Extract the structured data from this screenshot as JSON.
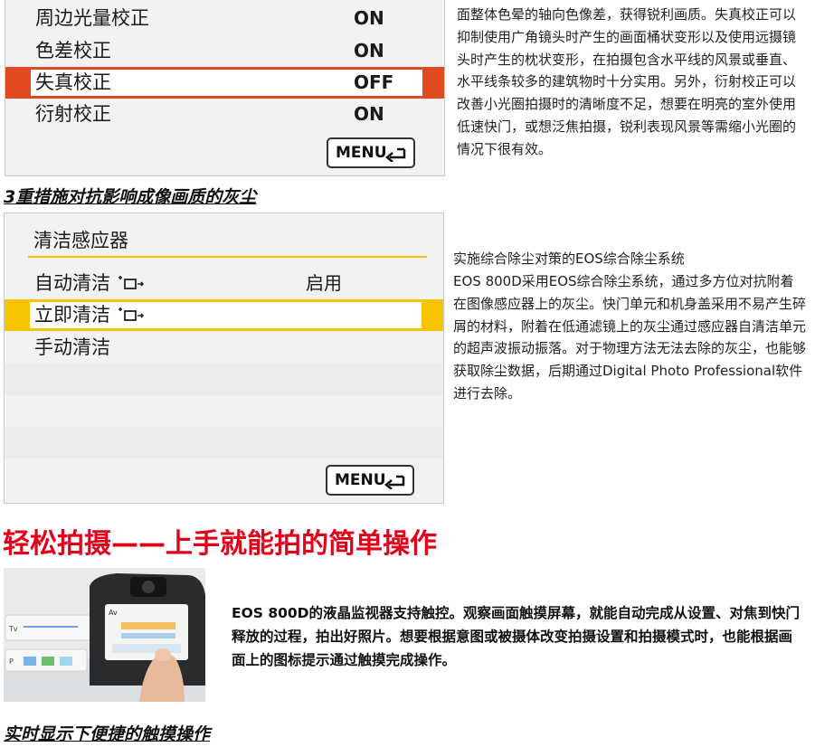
{
  "panel1": {
    "rows": [
      {
        "label": "周边光量校正",
        "value": "ON"
      },
      {
        "label": "色差校正",
        "value": "ON"
      },
      {
        "label": "失真校正",
        "value": "OFF"
      },
      {
        "label": "衍射校正",
        "value": "ON"
      }
    ],
    "menu_button": "MENU"
  },
  "paragraph1": "面整体色晕的轴向色像差，获得锐利画质。失真校正可以抑制使用广角镜头时产生的画面桶状变形以及使用远摄镜头时产生的枕状变形，在拍摄包含水平线的风景或垂直、水平线条较多的建筑物时十分实用。另外，衍射校正可以改善小光圈拍摄时的清晰度不足，想要在明亮的室外使用低速快门，或想泛焦拍摄，锐利表现风景等需缩小光圈的情况下很有效。",
  "section2_heading": "3重措施对抗影响成像画质的灰尘",
  "panel2": {
    "title": "清洁感应器",
    "rows": [
      {
        "label": "自动清洁",
        "value": "启用"
      },
      {
        "label": "立即清洁",
        "value": ""
      },
      {
        "label": "手动清洁",
        "value": ""
      }
    ],
    "menu_button": "MENU"
  },
  "paragraph2_title": "实施综合除尘对策的EOS综合除尘系统",
  "paragraph2": "EOS 800D采用EOS综合除尘系统，通过多方位对抗附着在图像感应器上的灰尘。快门单元和机身盖采用不易产生碎屑的材料，附着在低通滤镜上的灰尘通过感应器自清洁单元的超声波振动振落。对于物理方法无法去除的灰尘，也能够获取除尘数据，后期通过Digital Photo Professional软件进行去除。",
  "main_heading": "轻松拍摄——上手就能拍的简单操作",
  "touch_paragraph": "EOS 800D的液晶监视器支持触控。观察画面触摸屏幕，就能自动完成从设置、对焦到快门释放的过程，拍出好照片。想要根据意图或被摄体改变拍摄设置和拍摄模式时，也能根据画面上的图标提示通过触摸完成操作。",
  "photo_labels": {
    "tv": "Tv",
    "p": "P",
    "av": "Av"
  },
  "section3_heading": "实时显示下便捷的触摸操作",
  "colors": {
    "accent_red": "#e3001b",
    "selection_orange": "#e04a20",
    "selection_yellow": "#f6c500",
    "paragraph_link_blue": "#1f1f1f"
  }
}
